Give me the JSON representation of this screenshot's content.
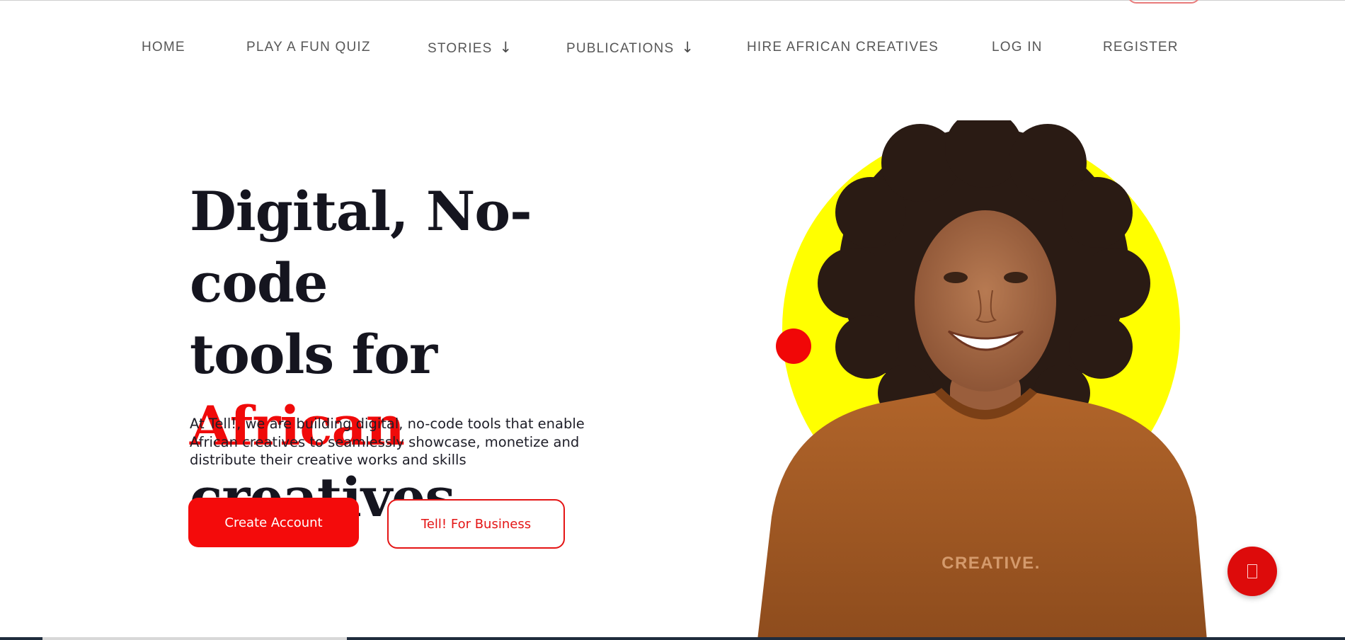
{
  "nav": {
    "items": [
      {
        "label": "HOME"
      },
      {
        "label": "PLAY A FUN QUIZ"
      },
      {
        "label": "STORIES",
        "arrow": "↓"
      },
      {
        "label": "PUBLICATIONS",
        "arrow": "↓"
      },
      {
        "label": "HIRE AFRICAN CREATIVES"
      },
      {
        "label": "LOG IN"
      },
      {
        "label": "REGISTER"
      }
    ]
  },
  "hero": {
    "title_line1": "Digital, No-code",
    "title_line2": "tools for",
    "title_accent": "African",
    "title_line3": "creatives",
    "description": "At Tell!, we are building digital, no-code tools that enable African creatives to seamlessly showcase, monetize and distribute their creative works and skills",
    "primary_button": "Create Account",
    "secondary_button": "Tell! For Business",
    "shirt_text": "CREATIVE."
  },
  "colors": {
    "accent_red": "#f00a0a",
    "hero_yellow": "#ffff00",
    "heading_dark": "#15151f",
    "shirt_brown": "#a55a24"
  },
  "icons": {
    "fab": "chat-icon"
  }
}
